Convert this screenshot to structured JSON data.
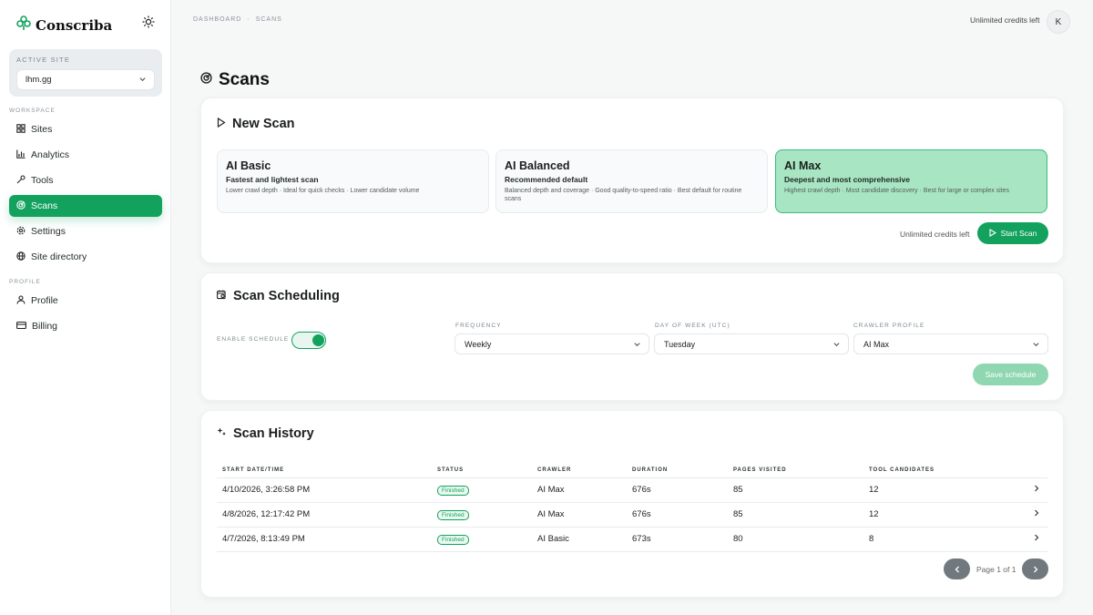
{
  "brand": {
    "name": "Conscriba"
  },
  "active_site": {
    "caption": "ACTIVE SITE",
    "value": "lhm.gg"
  },
  "sidebar": {
    "workspace_label": "WORKSPACE",
    "profile_label": "PROFILE",
    "items": [
      {
        "label": "Sites",
        "icon": "grid-icon"
      },
      {
        "label": "Analytics",
        "icon": "bar-chart-icon"
      },
      {
        "label": "Tools",
        "icon": "wrench-icon"
      },
      {
        "label": "Scans",
        "icon": "radar-icon",
        "active": true
      },
      {
        "label": "Settings",
        "icon": "gear-icon"
      },
      {
        "label": "Site directory",
        "icon": "globe-icon"
      },
      {
        "label": "Profile",
        "icon": "user-icon"
      },
      {
        "label": "Billing",
        "icon": "card-icon"
      }
    ]
  },
  "topbar": {
    "breadcrumb": [
      "DASHBOARD",
      "·",
      "SCANS"
    ],
    "credits": "Unlimited credits left",
    "avatar": "K"
  },
  "page": {
    "title": "Scans"
  },
  "new_scan": {
    "title": "New Scan",
    "modes": [
      {
        "title": "AI Basic",
        "subtitle": "Fastest and lightest scan",
        "desc": "Lower crawl depth · Ideal for quick checks · Lower candidate volume",
        "selected": false
      },
      {
        "title": "AI Balanced",
        "subtitle": "Recommended default",
        "desc": "Balanced depth and coverage · Good quality-to-speed ratio · Best default for routine scans",
        "selected": false
      },
      {
        "title": "AI Max",
        "subtitle": "Deepest and most comprehensive",
        "desc": "Highest crawl depth · Most candidate discovery · Best for large or complex sites",
        "selected": true
      }
    ],
    "credits": "Unlimited credits left",
    "start_label": "Start Scan"
  },
  "scheduling": {
    "title": "Scan Scheduling",
    "enable_label": "ENABLE SCHEDULE",
    "enabled": true,
    "frequency_label": "FREQUENCY",
    "frequency": "Weekly",
    "day_label": "DAY OF WEEK (UTC)",
    "day": "Tuesday",
    "profile_label": "CRAWLER PROFILE",
    "profile": "AI Max",
    "save_label": "Save schedule"
  },
  "history": {
    "title": "Scan History",
    "columns": [
      "START DATE/TIME",
      "STATUS",
      "CRAWLER",
      "DURATION",
      "PAGES VISITED",
      "TOOL CANDIDATES"
    ],
    "rows": [
      {
        "start": "4/10/2026, 3:26:58 PM",
        "status": "Finished",
        "crawler": "AI Max",
        "duration": "676s",
        "pages": "85",
        "candidates": "12"
      },
      {
        "start": "4/8/2026, 12:17:42 PM",
        "status": "Finished",
        "crawler": "AI Max",
        "duration": "676s",
        "pages": "85",
        "candidates": "12"
      },
      {
        "start": "4/7/2026, 8:13:49 PM",
        "status": "Finished",
        "crawler": "AI Basic",
        "duration": "673s",
        "pages": "80",
        "candidates": "8"
      }
    ],
    "page_label": "Page 1 of 1"
  },
  "colors": {
    "accent": "#13a25e",
    "selected_card": "#a8e5c3",
    "save_disabled": "#8fd7b1"
  }
}
